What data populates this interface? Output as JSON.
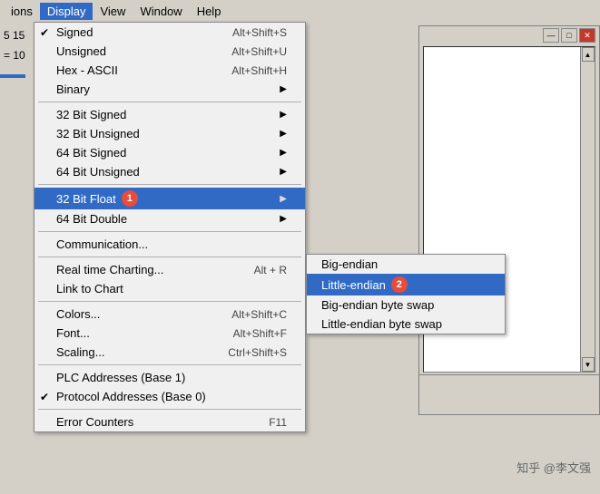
{
  "menubar": {
    "items": [
      {
        "label": "ions",
        "active": false
      },
      {
        "label": "Display",
        "active": true
      },
      {
        "label": "View",
        "active": false
      },
      {
        "label": "Window",
        "active": false
      },
      {
        "label": "Help",
        "active": false
      }
    ]
  },
  "partial_display": {
    "text1": "ions",
    "text2": "5 15",
    "text3": "= 10"
  },
  "window_buttons": {
    "minimize": "—",
    "restore": "□",
    "close": "✕"
  },
  "display_menu": {
    "items": [
      {
        "id": "signed",
        "label": "Signed",
        "shortcut": "Alt+Shift+S",
        "check": true,
        "has_arrow": false,
        "highlighted": false
      },
      {
        "id": "unsigned",
        "label": "Unsigned",
        "shortcut": "Alt+Shift+U",
        "check": false,
        "has_arrow": false,
        "highlighted": false
      },
      {
        "id": "hex_ascii",
        "label": "Hex - ASCII",
        "shortcut": "Alt+Shift+H",
        "check": false,
        "has_arrow": false,
        "highlighted": false
      },
      {
        "id": "binary",
        "label": "Binary",
        "shortcut": "",
        "check": false,
        "has_arrow": true,
        "highlighted": false
      },
      {
        "id": "sep1",
        "type": "separator"
      },
      {
        "id": "32bit_signed",
        "label": "32 Bit Signed",
        "shortcut": "",
        "check": false,
        "has_arrow": true,
        "highlighted": false
      },
      {
        "id": "32bit_unsigned",
        "label": "32 Bit Unsigned",
        "shortcut": "",
        "check": false,
        "has_arrow": true,
        "highlighted": false
      },
      {
        "id": "64bit_signed",
        "label": "64 Bit Signed",
        "shortcut": "",
        "check": false,
        "has_arrow": true,
        "highlighted": false
      },
      {
        "id": "64bit_unsigned",
        "label": "64 Bit Unsigned",
        "shortcut": "",
        "check": false,
        "has_arrow": true,
        "highlighted": false
      },
      {
        "id": "sep2",
        "type": "separator"
      },
      {
        "id": "32bit_float",
        "label": "32 Bit Float",
        "shortcut": "",
        "check": false,
        "has_arrow": true,
        "highlighted": true,
        "badge": "1"
      },
      {
        "id": "64bit_double",
        "label": "64 Bit Double",
        "shortcut": "",
        "check": false,
        "has_arrow": true,
        "highlighted": false
      },
      {
        "id": "sep3",
        "type": "separator"
      },
      {
        "id": "communication",
        "label": "Communication...",
        "shortcut": "",
        "check": false,
        "has_arrow": false,
        "highlighted": false
      },
      {
        "id": "sep4",
        "type": "separator"
      },
      {
        "id": "realtime_charting",
        "label": "Real time Charting...",
        "shortcut": "Alt + R",
        "check": false,
        "has_arrow": false,
        "highlighted": false
      },
      {
        "id": "link_to_chart",
        "label": "Link to Chart",
        "shortcut": "",
        "check": false,
        "has_arrow": false,
        "highlighted": false
      },
      {
        "id": "sep5",
        "type": "separator"
      },
      {
        "id": "colors",
        "label": "Colors...",
        "shortcut": "Alt+Shift+C",
        "check": false,
        "has_arrow": false,
        "highlighted": false
      },
      {
        "id": "font",
        "label": "Font...",
        "shortcut": "Alt+Shift+F",
        "check": false,
        "has_arrow": false,
        "highlighted": false
      },
      {
        "id": "scaling",
        "label": "Scaling...",
        "shortcut": "Ctrl+Shift+S",
        "check": false,
        "has_arrow": false,
        "highlighted": false
      },
      {
        "id": "sep6",
        "type": "separator"
      },
      {
        "id": "plc_addresses",
        "label": "PLC Addresses (Base 1)",
        "shortcut": "",
        "check": false,
        "has_arrow": false,
        "highlighted": false
      },
      {
        "id": "protocol_addresses",
        "label": "Protocol Addresses (Base 0)",
        "shortcut": "",
        "check": true,
        "has_arrow": false,
        "highlighted": false
      },
      {
        "id": "sep7",
        "type": "separator"
      },
      {
        "id": "error_counters",
        "label": "Error Counters",
        "shortcut": "F11",
        "check": false,
        "has_arrow": false,
        "highlighted": false
      }
    ]
  },
  "submenu": {
    "items": [
      {
        "id": "big_endian",
        "label": "Big-endian",
        "highlighted": false
      },
      {
        "id": "little_endian",
        "label": "Little-endian",
        "highlighted": true,
        "badge": "2"
      },
      {
        "id": "big_endian_swap",
        "label": "Big-endian byte swap",
        "highlighted": false
      },
      {
        "id": "little_endian_swap",
        "label": "Little-endian byte swap",
        "highlighted": false
      }
    ]
  },
  "watermark": {
    "text": "知乎 @李文强"
  }
}
